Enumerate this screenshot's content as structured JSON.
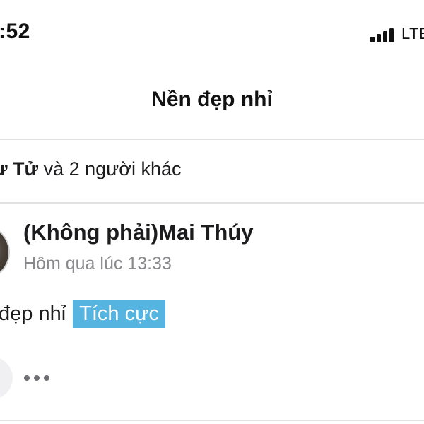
{
  "status_bar": {
    "time": ":52",
    "network": "LTE",
    "signal_icon": "cellular-signal-icon",
    "signal_bars": 4
  },
  "header": {
    "title": "Nền đẹp nhỉ"
  },
  "likes": {
    "likers": "ư Tử",
    "others": " và 2 người khác"
  },
  "comment": {
    "author": "(Không phải)Mai Thúy",
    "timestamp": "Hôm qua lúc 13:33",
    "text": "đẹp nhỉ",
    "sentiment_tag": "Tích cực",
    "more_icon": "more-dots-icon"
  },
  "colors": {
    "sentiment_tag_bg": "#56b4e0",
    "divider": "#e2e2e4",
    "secondary_text": "#8a8a8e"
  }
}
